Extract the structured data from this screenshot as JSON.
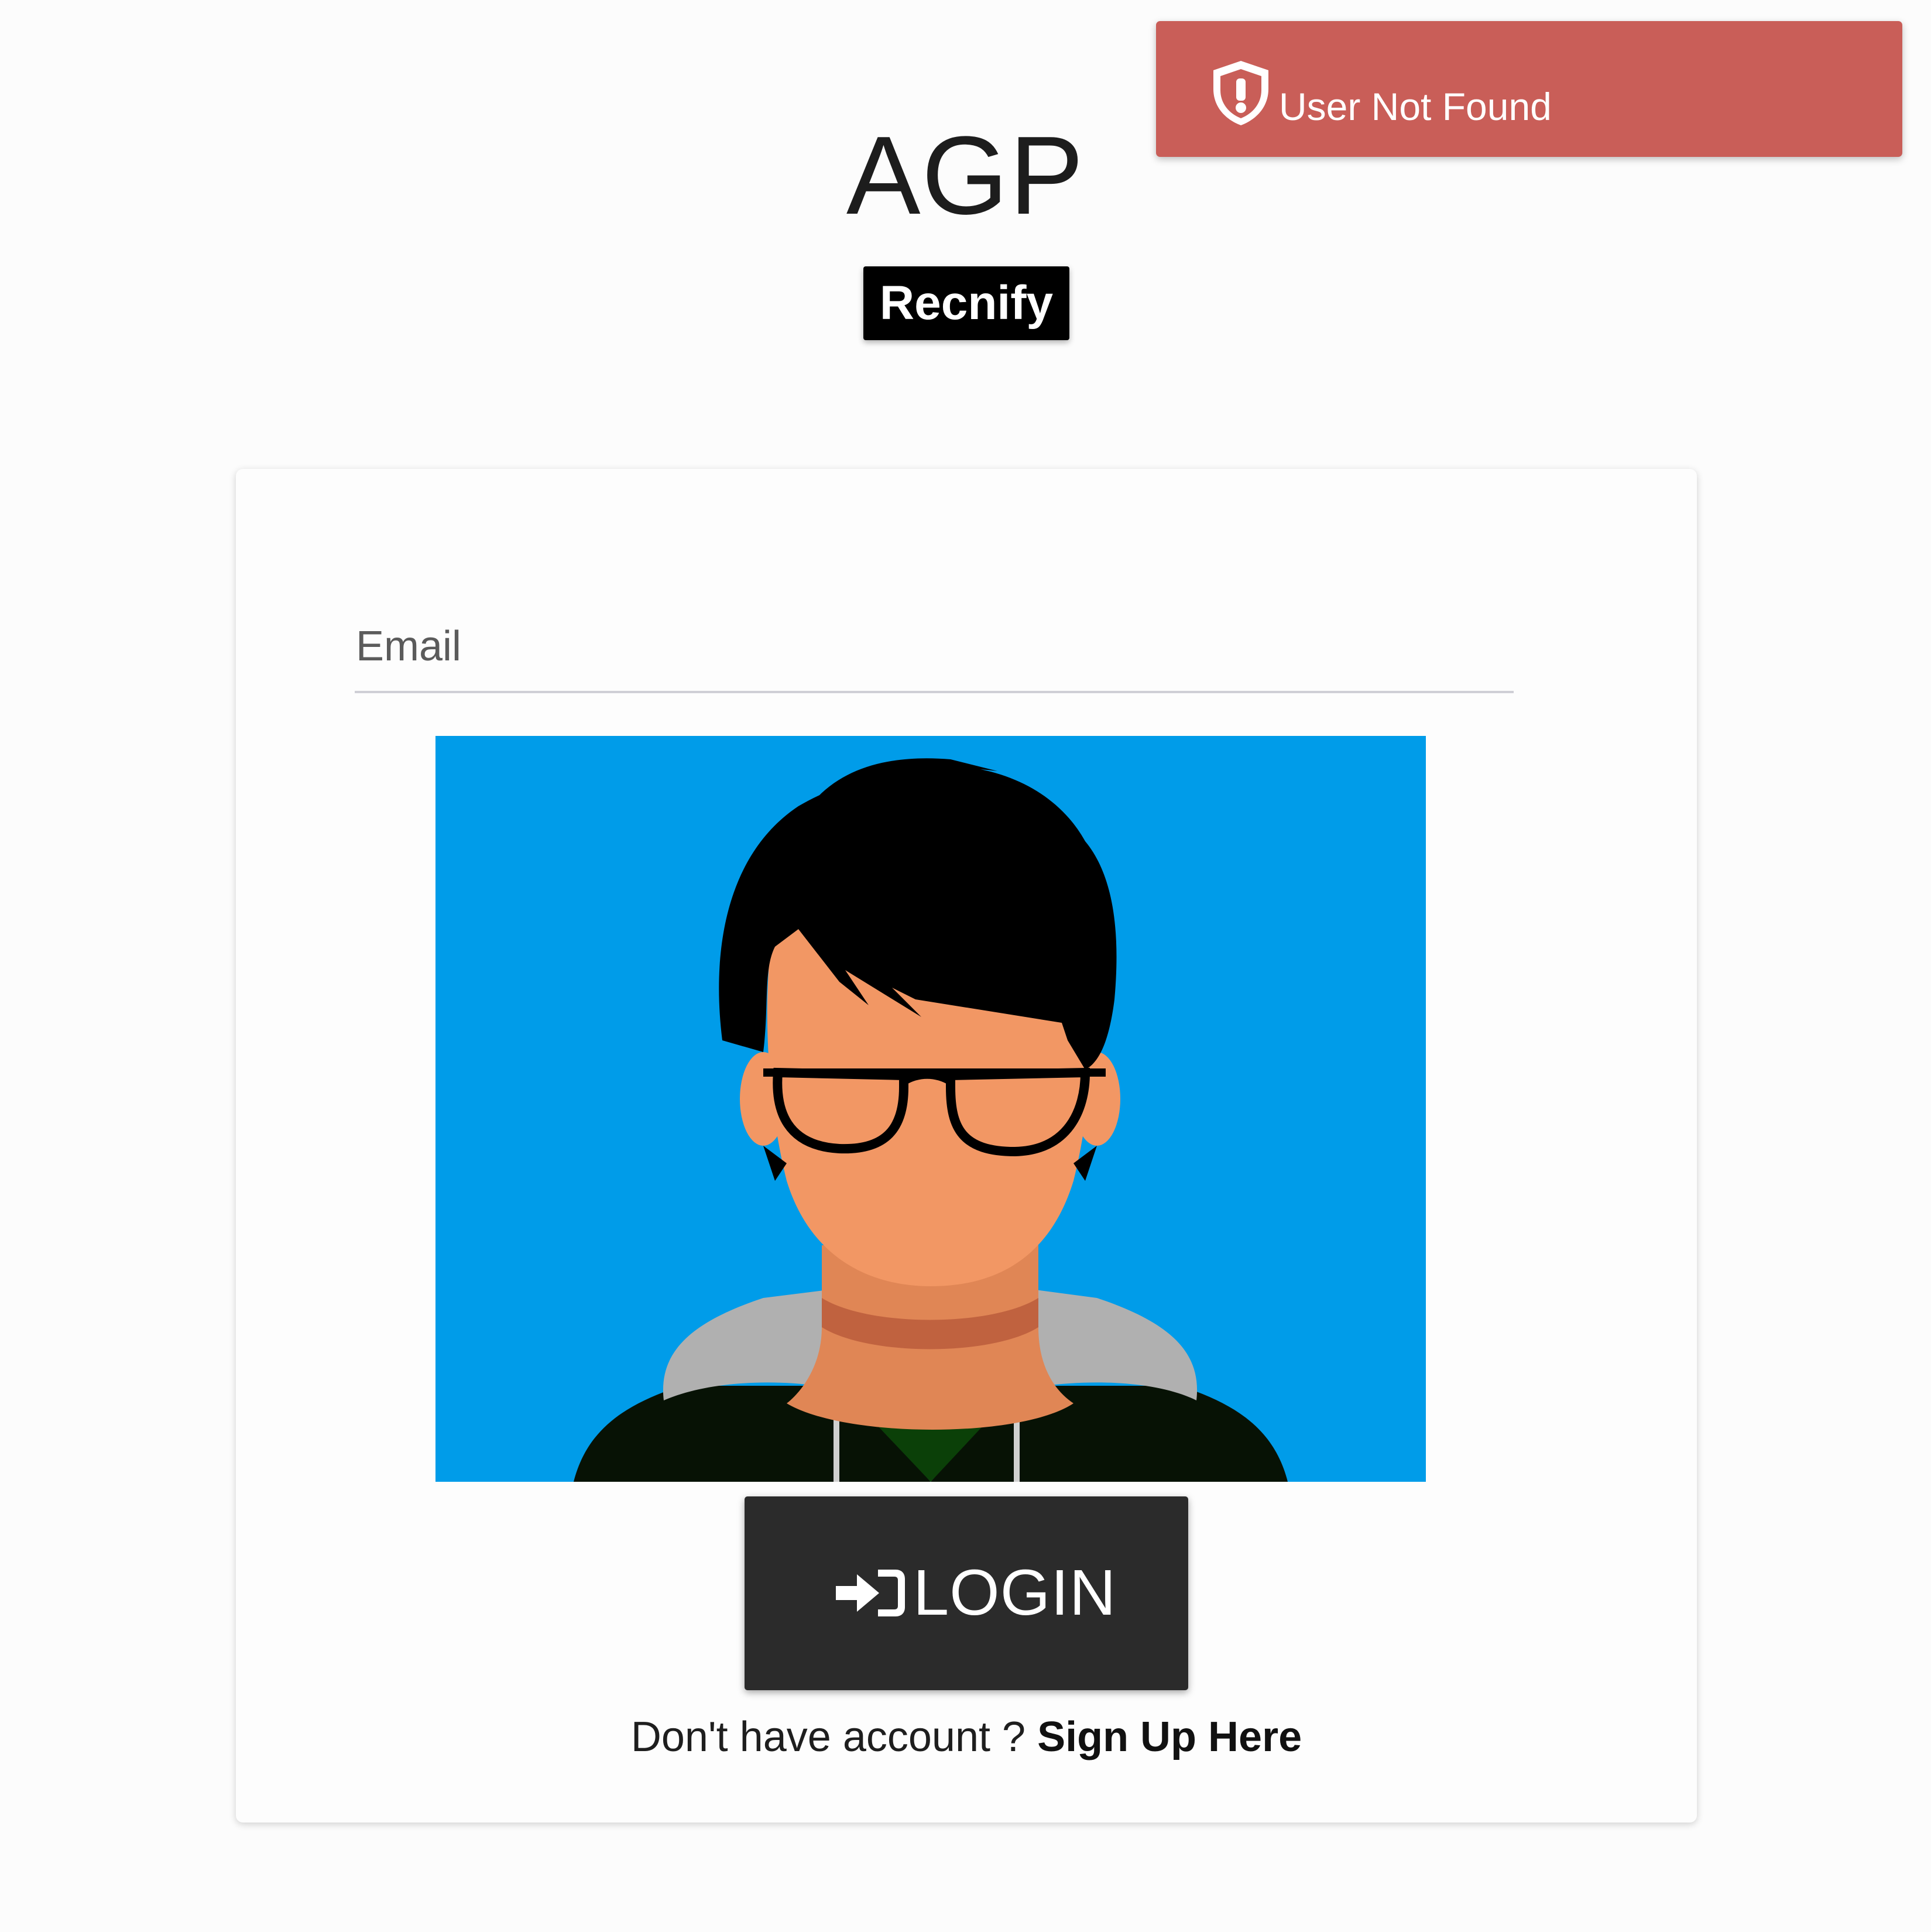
{
  "toast": {
    "message": "User Not Found",
    "icon": "shield-alert-icon",
    "color": "#c95e58"
  },
  "header": {
    "title": "AGP",
    "brand": "Recnify"
  },
  "form": {
    "email_label": "Email",
    "email_value": "",
    "avatar": "person-avatar-illustration",
    "avatar_background": "#009ce9",
    "login_label": "LOGIN",
    "login_icon": "sign-in-icon",
    "signup_prompt": "Don't have account ?",
    "signup_link": "Sign Up Here"
  }
}
